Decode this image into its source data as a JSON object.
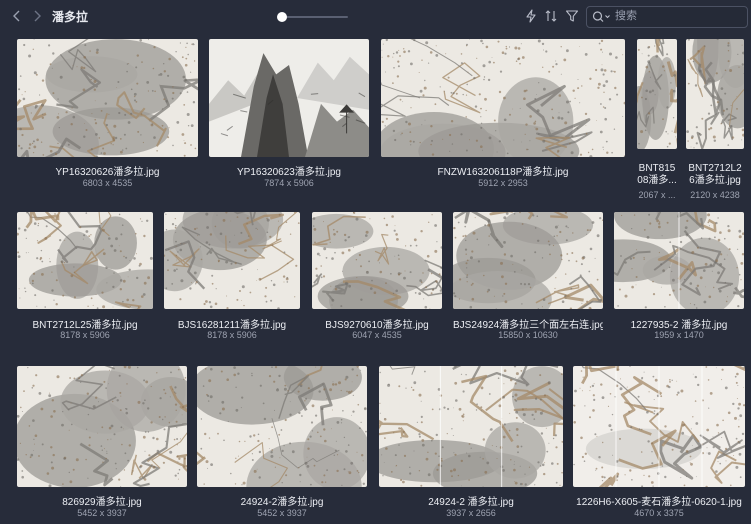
{
  "folder": {
    "title": "潘多拉"
  },
  "zoom": {
    "value": 0.05
  },
  "search": {
    "placeholder": "搜索"
  },
  "colors": {
    "background": "#272c3a",
    "text": "#eceef3",
    "subtext": "#9ea3b1",
    "accent": "#ffffff"
  },
  "icons": {
    "back": "chevron-left-icon",
    "forward": "chevron-right-icon",
    "filter_quick": "lightning-icon",
    "sort": "sort-icon",
    "filter": "funnel-icon",
    "search": "search-icon"
  },
  "files": [
    {
      "name": "YP16320626潘多拉.jpg",
      "dimensions": "6803 x 4535",
      "kind": "marble"
    },
    {
      "name": "YP16320623潘多拉.jpg",
      "dimensions": "7874 x 5906",
      "kind": "landscape"
    },
    {
      "name": "FNZW163206118P潘多拉.jpg",
      "dimensions": "5912 x 2953",
      "kind": "marble"
    },
    {
      "name_lines": [
        "BNT815",
        "08潘多..."
      ],
      "dimensions": "2067 x ...",
      "kind": "marble"
    },
    {
      "name_lines": [
        "BNT2712L2",
        "6潘多拉.jpg"
      ],
      "dimensions": "2120 x 4238",
      "kind": "marble"
    },
    {
      "name": "BNT2712L25潘多拉.jpg",
      "dimensions": "8178 x 5906",
      "kind": "marble"
    },
    {
      "name": "BJS16281211潘多拉.jpg",
      "dimensions": "8178 x 5906",
      "kind": "marble"
    },
    {
      "name": "BJS9270610潘多拉.jpg",
      "dimensions": "6047 x 4535",
      "kind": "marble"
    },
    {
      "name": "BJS24924潘多拉三个面左右连.jpg",
      "dimensions": "15850 x 10630",
      "kind": "marble"
    },
    {
      "name": "1227935-2 潘多拉.jpg",
      "dimensions": "1959 x 1470",
      "kind": "marble"
    },
    {
      "name": "826929潘多拉.jpg",
      "dimensions": "5452 x 3937",
      "kind": "marble"
    },
    {
      "name": "24924-2潘多拉.jpg",
      "dimensions": "5452 x 3937",
      "kind": "marble"
    },
    {
      "name": "24924-2 潘多拉.jpg",
      "dimensions": "3937 x 2656",
      "kind": "marble"
    },
    {
      "name": "1226H6-X605-麦石潘多拉-0620-1.jpg",
      "dimensions": "4670 x 3375",
      "kind": "marble"
    }
  ]
}
